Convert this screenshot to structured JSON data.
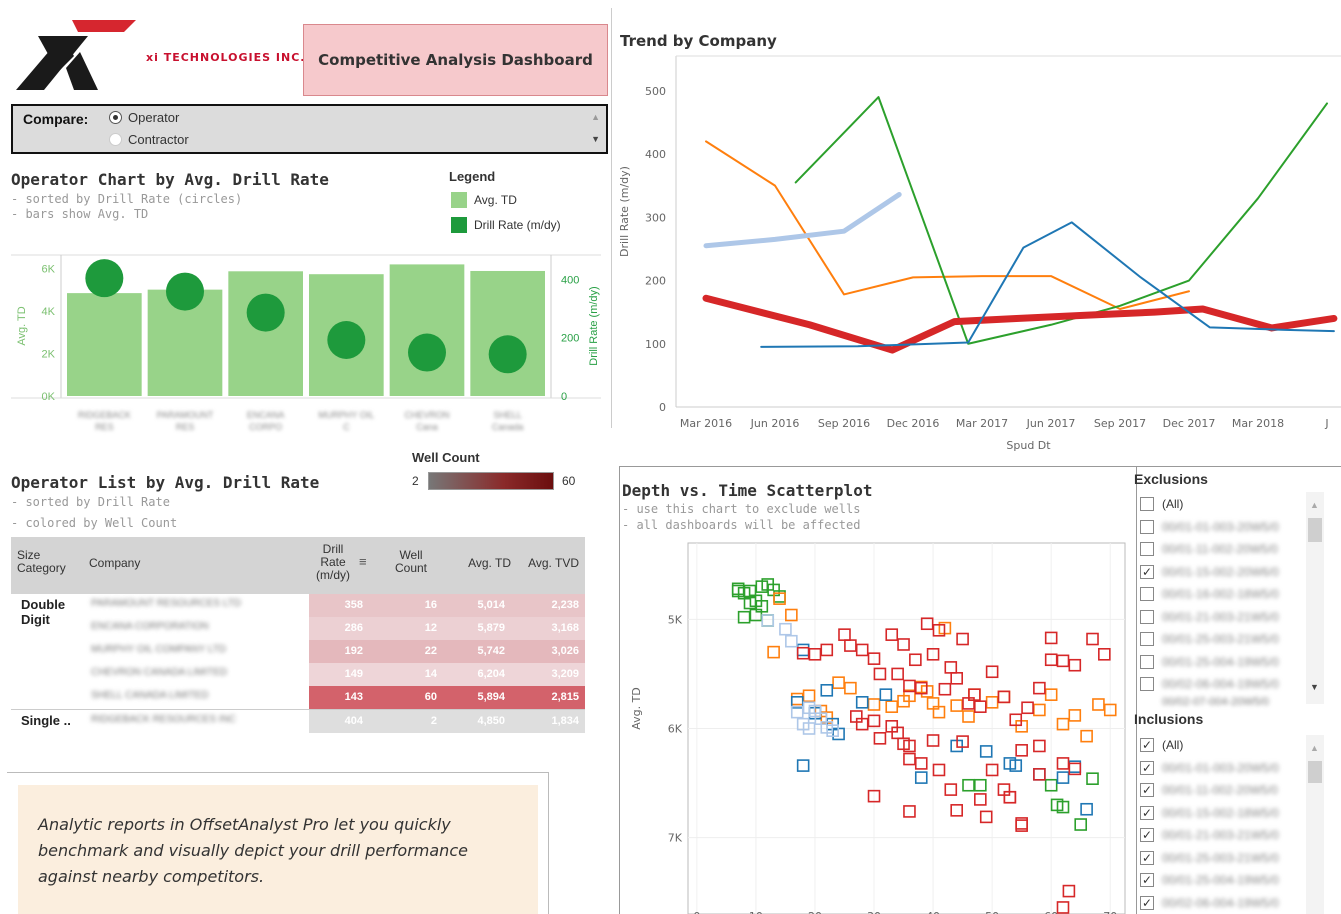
{
  "header": {
    "company_name": "xi TECHNOLOGIES INC.",
    "dashboard_title": "Competitive Analysis Dashboard"
  },
  "compare": {
    "label": "Compare:",
    "options": [
      "Operator",
      "Contractor"
    ],
    "selected": "Operator"
  },
  "operator_chart": {
    "title": "Operator Chart by Avg. Drill Rate",
    "subtitle_1": "- sorted by Drill Rate (circles)",
    "subtitle_2": "- bars show Avg. TD",
    "legend_title": "Legend",
    "legend_items": [
      "Avg. TD",
      "Drill Rate (m/dy)"
    ],
    "colors": {
      "bar": "#98d389",
      "circle": "#1e9a3c"
    }
  },
  "well_count_legend": {
    "title": "Well Count",
    "min": "2",
    "max": "60"
  },
  "operator_list": {
    "title": "Operator List by Avg. Drill Rate",
    "subtitle_1": "- sorted by Drill Rate",
    "subtitle_2": "- colored by Well Count",
    "headers": [
      "Size Category",
      "Company",
      "Drill Rate (m/dy)",
      "Well Count",
      "Avg. TD",
      "Avg. TVD"
    ],
    "groups": [
      {
        "category": "Double Digit",
        "rows": [
          {
            "company": "PARAMOUNT RESOURCES LTD",
            "drill_rate": "358",
            "well_count": "16",
            "avg_td": "5,014",
            "avg_tvd": "2,238"
          },
          {
            "company": "ENCANA CORPORATION",
            "drill_rate": "286",
            "well_count": "12",
            "avg_td": "5,879",
            "avg_tvd": "3,168"
          },
          {
            "company": "MURPHY OIL COMPANY LTD",
            "drill_rate": "192",
            "well_count": "22",
            "avg_td": "5,742",
            "avg_tvd": "3,026"
          },
          {
            "company": "CHEVRON CANADA LIMITED",
            "drill_rate": "149",
            "well_count": "14",
            "avg_td": "6,204",
            "avg_tvd": "3,209"
          },
          {
            "company": "SHELL CANADA LIMITED",
            "drill_rate": "143",
            "well_count": "60",
            "avg_td": "5,894",
            "avg_tvd": "2,815"
          }
        ]
      },
      {
        "category": "Single ..",
        "rows": [
          {
            "company": "RIDGEBACK RESOURCES INC",
            "drill_rate": "404",
            "well_count": "2",
            "avg_td": "4,850",
            "avg_tvd": "1,834"
          }
        ]
      }
    ]
  },
  "callout": {
    "text": "Analytic reports in OffsetAnalyst Pro let you quickly benchmark and visually depict your drill performance against nearby competitors."
  },
  "filters": {
    "exclusions_title": "Exclusions",
    "inclusions_title": "Inclusions",
    "all_label": "(All)",
    "exclusion_items": [
      {
        "label": "00/01-01-003-20W5/0",
        "checked": false
      },
      {
        "label": "00/01-11-002-20W5/0",
        "checked": false
      },
      {
        "label": "00/01-15-002-20W6/0",
        "checked": true
      },
      {
        "label": "00/01-16-002-18W5/0",
        "checked": false
      },
      {
        "label": "00/01-21-003-21W5/0",
        "checked": false
      },
      {
        "label": "00/01-25-003-21W5/0",
        "checked": false
      },
      {
        "label": "00/01-25-004-19W5/0",
        "checked": false
      },
      {
        "label": "00/02-06-004-19W5/0",
        "checked": false
      }
    ],
    "inclusion_items": [
      "00/01-01-003-20W5/0",
      "00/01-11-002-20W5/0",
      "00/01-15-002-18W5/0",
      "00/01-21-003-21W5/0",
      "00/01-25-003-21W5/0",
      "00/01-25-004-19W5/0",
      "00/02-06-004-19W5/0"
    ],
    "partial_item": "00/02-07-004-20W5/0"
  },
  "chart_data": [
    {
      "type": "bar",
      "title": "Operator Chart by Avg. Drill Rate",
      "categories": [
        "RIDGEBACK RES",
        "PARAMOUNT RES",
        "ENCANA CORPO",
        "MURPHY OIL C",
        "CHEVRON Cana",
        "SHELL Canada"
      ],
      "series": [
        {
          "name": "Avg. TD",
          "values": [
            4850,
            5014,
            5879,
            5742,
            6204,
            5894
          ]
        },
        {
          "name": "Drill Rate (m/dy)",
          "values": [
            404,
            358,
            286,
            192,
            149,
            143
          ]
        }
      ],
      "ylabel": "Avg. TD",
      "y2label": "Drill Rate (m/dy)",
      "ylim": [
        0,
        6000
      ],
      "y2lim": [
        0,
        450
      ],
      "yticks": [
        "0K",
        "2K",
        "4K",
        "6K"
      ],
      "y2ticks": [
        "0",
        "200",
        "400"
      ]
    },
    {
      "type": "line",
      "title": "Trend by Company",
      "xlabel": "Spud Dt",
      "ylabel": "Drill Rate (m/dy)",
      "x_ticks": [
        "Mar 2016",
        "Jun 2016",
        "Sep 2016",
        "Dec 2016",
        "Mar 2017",
        "Jun 2017",
        "Sep 2017",
        "Dec 2017",
        "Mar 2018",
        "J"
      ],
      "y_ticks": [
        "0",
        "100",
        "200",
        "300",
        "400",
        "500"
      ],
      "ylim": [
        0,
        500
      ],
      "series": [
        {
          "color": "#ff7f0e",
          "width": 2,
          "x": [
            0,
            1,
            2,
            3,
            4,
            5,
            6,
            7
          ],
          "y": [
            420,
            350,
            178,
            205,
            207,
            207,
            155,
            183
          ]
        },
        {
          "color": "#2ca02c",
          "width": 2,
          "x": [
            1.3,
            2.5,
            3.8,
            5,
            6,
            7,
            8,
            9
          ],
          "y": [
            355,
            490,
            100,
            130,
            160,
            200,
            330,
            480
          ]
        },
        {
          "color": "#aec7e8",
          "width": 5,
          "x": [
            0,
            1,
            2,
            2.8
          ],
          "y": [
            255,
            265,
            278,
            336
          ]
        },
        {
          "color": "#d62728",
          "width": 7,
          "x": [
            0,
            1.5,
            2.7,
            3.6,
            4.5,
            5.5,
            6.5,
            7.2,
            8.2,
            9.1
          ],
          "y": [
            172,
            130,
            90,
            135,
            140,
            145,
            150,
            155,
            125,
            140
          ]
        },
        {
          "color": "#1f77b4",
          "width": 2,
          "x": [
            0.8,
            2.2,
            3.8,
            4.6,
            5.3,
            6.3,
            7.3,
            8.4,
            9.1
          ],
          "y": [
            95,
            96,
            102,
            252,
            292,
            205,
            126,
            122,
            120
          ]
        }
      ]
    },
    {
      "type": "scatter",
      "title": "Depth vs. Time Scatterplot",
      "ylabel": "Avg. TD",
      "x_ticks": [
        "0",
        "10",
        "20",
        "30",
        "40",
        "50",
        "60",
        "70"
      ],
      "y_ticks": [
        "5K",
        "6K",
        "7K"
      ],
      "xlim": [
        0,
        73
      ],
      "ylim": [
        4300,
        7700
      ],
      "series": [
        {
          "name": "green",
          "color": "#2ca02c",
          "points": [
            [
              7,
              4720
            ],
            [
              8,
              4760
            ],
            [
              9,
              4740
            ],
            [
              10,
              4830
            ],
            [
              11,
              4700
            ],
            [
              12,
              4680
            ],
            [
              13,
              4730
            ],
            [
              14,
              4790
            ],
            [
              8,
              4980
            ],
            [
              10,
              4960
            ],
            [
              12,
              5010
            ],
            [
              11,
              4880
            ],
            [
              9,
              4850
            ],
            [
              7,
              4740
            ],
            [
              46,
              6520
            ],
            [
              48,
              6520
            ],
            [
              60,
              6520
            ],
            [
              61,
              6700
            ],
            [
              62,
              6720
            ],
            [
              67,
              6460
            ],
            [
              65,
              6880
            ]
          ]
        },
        {
          "name": "orange",
          "color": "#ff7f0e",
          "points": [
            [
              14,
              4810
            ],
            [
              13,
              5300
            ],
            [
              16,
              4960
            ],
            [
              17,
              5730
            ],
            [
              19,
              5700
            ],
            [
              21,
              5840
            ],
            [
              22,
              5900
            ],
            [
              24,
              5580
            ],
            [
              26,
              5630
            ],
            [
              30,
              5780
            ],
            [
              33,
              5800
            ],
            [
              35,
              5750
            ],
            [
              36,
              5700
            ],
            [
              38,
              5620
            ],
            [
              39,
              5660
            ],
            [
              40,
              5770
            ],
            [
              41,
              5850
            ],
            [
              42,
              5080
            ],
            [
              44,
              5790
            ],
            [
              46,
              5890
            ],
            [
              47,
              5690
            ],
            [
              50,
              5760
            ],
            [
              52,
              5710
            ],
            [
              55,
              5980
            ],
            [
              58,
              5830
            ],
            [
              60,
              5690
            ],
            [
              62,
              5960
            ],
            [
              64,
              5880
            ],
            [
              66,
              6070
            ],
            [
              68,
              5780
            ],
            [
              70,
              5830
            ]
          ]
        },
        {
          "name": "blue",
          "color": "#1f77b4",
          "points": [
            [
              18,
              5280
            ],
            [
              20,
              5860
            ],
            [
              22,
              5650
            ],
            [
              23,
              5960
            ],
            [
              24,
              6050
            ],
            [
              28,
              5760
            ],
            [
              32,
              5690
            ],
            [
              38,
              6450
            ],
            [
              44,
              6160
            ],
            [
              49,
              6210
            ],
            [
              53,
              6320
            ],
            [
              54,
              6340
            ],
            [
              58,
              6420
            ],
            [
              62,
              6450
            ],
            [
              64,
              6350
            ],
            [
              66,
              6740
            ],
            [
              18,
              6340
            ],
            [
              17,
              5760
            ]
          ]
        },
        {
          "name": "lightblue",
          "color": "#aec7e8",
          "points": [
            [
              15,
              5090
            ],
            [
              17,
              5850
            ],
            [
              18,
              5960
            ],
            [
              19,
              5810
            ],
            [
              20,
              5840
            ],
            [
              21,
              5910
            ],
            [
              22,
              5990
            ],
            [
              23,
              6020
            ],
            [
              19,
              6000
            ],
            [
              16,
              5200
            ],
            [
              12,
              5010
            ]
          ]
        },
        {
          "name": "red",
          "color": "#d62728",
          "points": [
            [
              18,
              5310
            ],
            [
              22,
              5280
            ],
            [
              25,
              5140
            ],
            [
              28,
              5280
            ],
            [
              30,
              5360
            ],
            [
              33,
              5140
            ],
            [
              35,
              5230
            ],
            [
              37,
              5370
            ],
            [
              39,
              5040
            ],
            [
              41,
              5100
            ],
            [
              43,
              5440
            ],
            [
              45,
              5180
            ],
            [
              20,
              5320
            ],
            [
              26,
              5240
            ],
            [
              31,
              5500
            ],
            [
              34,
              5500
            ],
            [
              36,
              5610
            ],
            [
              38,
              5630
            ],
            [
              40,
              5320
            ],
            [
              42,
              5640
            ],
            [
              44,
              5540
            ],
            [
              46,
              5770
            ],
            [
              47,
              5690
            ],
            [
              48,
              5800
            ],
            [
              50,
              5480
            ],
            [
              52,
              5710
            ],
            [
              54,
              5920
            ],
            [
              56,
              5810
            ],
            [
              58,
              5630
            ],
            [
              60,
              5370
            ],
            [
              62,
              5380
            ],
            [
              64,
              5420
            ],
            [
              60,
              5170
            ],
            [
              58,
              6420
            ],
            [
              52,
              6560
            ],
            [
              53,
              6630
            ],
            [
              55,
              6870
            ],
            [
              49,
              6810
            ],
            [
              43,
              6560
            ],
            [
              41,
              6380
            ],
            [
              38,
              6320
            ],
            [
              36,
              6280
            ],
            [
              35,
              6140
            ],
            [
              34,
              6040
            ],
            [
              33,
              5980
            ],
            [
              30,
              5930
            ],
            [
              28,
              5960
            ],
            [
              27,
              5890
            ],
            [
              31,
              6090
            ],
            [
              36,
              6160
            ],
            [
              40,
              6110
            ],
            [
              45,
              6120
            ],
            [
              50,
              6380
            ],
            [
              55,
              6200
            ],
            [
              58,
              6160
            ],
            [
              62,
              6320
            ],
            [
              64,
              6370
            ],
            [
              48,
              6650
            ],
            [
              55,
              6890
            ],
            [
              53,
              6630
            ],
            [
              44,
              6750
            ],
            [
              36,
              6760
            ],
            [
              30,
              6620
            ],
            [
              55,
              7820
            ],
            [
              63,
              7490
            ],
            [
              62,
              7640
            ],
            [
              68,
              7840
            ],
            [
              47,
              7700
            ],
            [
              50,
              7800
            ],
            [
              67,
              5180
            ],
            [
              69,
              5320
            ]
          ]
        }
      ]
    }
  ]
}
